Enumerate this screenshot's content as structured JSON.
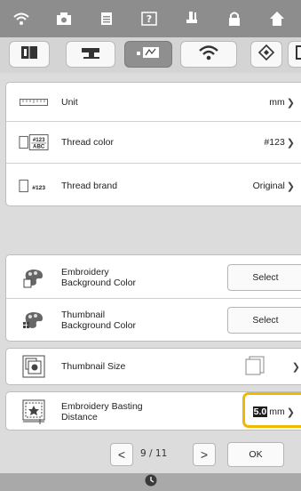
{
  "topbar": {
    "icons": [
      "wifi-icon",
      "camera-icon",
      "document-icon",
      "help-icon",
      "embroidery-foot-icon",
      "lock-icon",
      "home-icon"
    ]
  },
  "tabs": [
    {
      "icon": "book-icon",
      "active": false
    },
    {
      "icon": "sewing-machine-icon",
      "active": false
    },
    {
      "icon": "embroidery-frame-icon",
      "active": true
    },
    {
      "icon": "wifi-icon",
      "active": false
    },
    {
      "icon": "settings-diamond-icon",
      "active": false
    },
    {
      "icon": "frame-icon",
      "active": false
    }
  ],
  "settings": {
    "unit": {
      "label": "Unit",
      "value": "mm"
    },
    "thread_color": {
      "label": "Thread color",
      "value": "#123"
    },
    "thread_brand": {
      "label": "Thread brand",
      "value": "Original",
      "icon_text": "#123"
    },
    "embroidery_bg": {
      "label": "Embroidery\nBackground Color",
      "button": "Select"
    },
    "thumbnail_bg": {
      "label": "Thumbnail\nBackground Color",
      "button": "Select"
    },
    "thumbnail_size": {
      "label": "Thumbnail Size"
    },
    "basting": {
      "label": "Embroidery Basting\nDistance",
      "value": "5.0",
      "unit": "mm"
    }
  },
  "icon_text": {
    "thread_color_top": "#123",
    "thread_color_bottom": "ABC"
  },
  "pager": {
    "current": "9",
    "separator": "/",
    "total": "11",
    "ok_label": "OK"
  },
  "colors": {
    "accent": "#f0b800",
    "topbar": "#8d8d8d"
  }
}
